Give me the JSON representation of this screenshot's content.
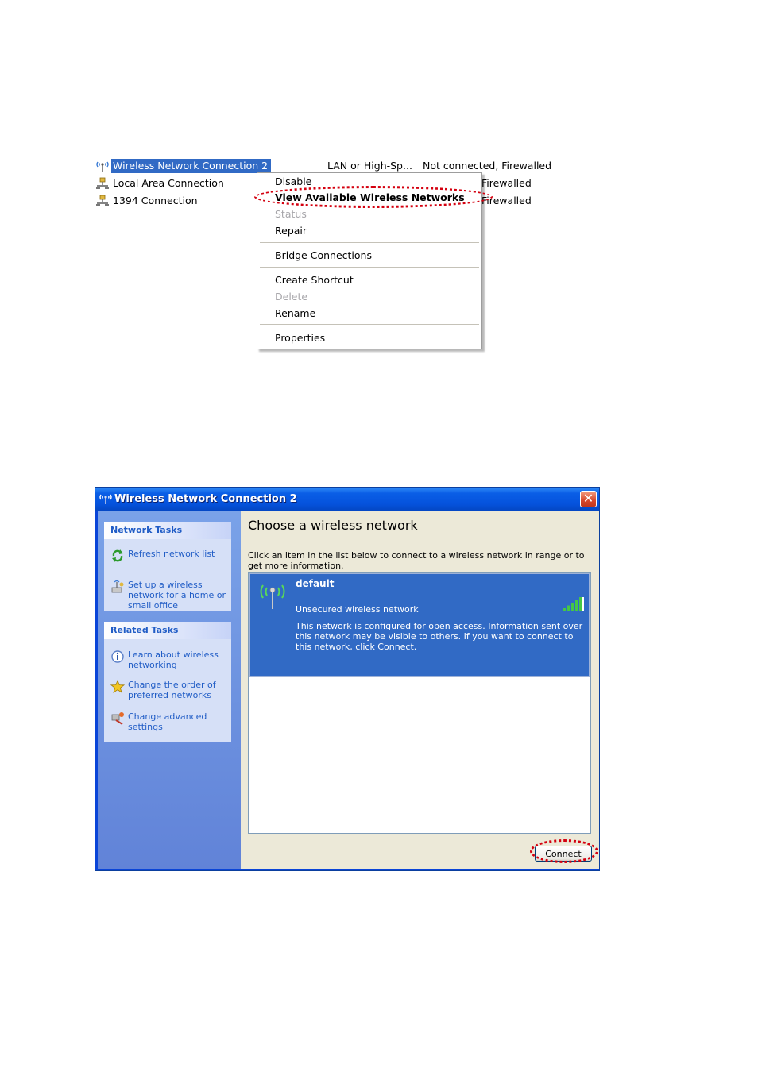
{
  "connections": {
    "rows": [
      {
        "name": "Wireless Network Connection 2",
        "type": "LAN or High-Sp...",
        "status": "Not connected, Firewalled",
        "icon": "wireless-icon",
        "selected": true
      },
      {
        "name": "Local Area Connection",
        "status_partial": "Firewalled",
        "icon": "lan-icon",
        "selected": false
      },
      {
        "name": "1394 Connection",
        "status_partial": "Firewalled",
        "icon": "lan-icon",
        "selected": false
      }
    ]
  },
  "context_menu": {
    "items": [
      {
        "label": "Disable"
      },
      {
        "label": "View Available Wireless Networks",
        "default": true
      },
      {
        "label": "Status",
        "disabled": true
      },
      {
        "label": "Repair"
      },
      {
        "label": "Bridge Connections"
      },
      {
        "label": "Create Shortcut"
      },
      {
        "label": "Delete",
        "disabled": true
      },
      {
        "label": "Rename"
      },
      {
        "label": "Properties"
      }
    ]
  },
  "window": {
    "title": "Wireless Network Connection 2",
    "close_glyph": "✕",
    "network_tasks": {
      "heading": "Network Tasks",
      "items": [
        {
          "label": "Refresh network list",
          "icon": "refresh-icon"
        },
        {
          "label": "Set up a wireless network for a home or small office",
          "icon": "setup-wireless-icon"
        }
      ]
    },
    "related_tasks": {
      "heading": "Related Tasks",
      "items": [
        {
          "label": "Learn about wireless networking",
          "icon": "info-icon"
        },
        {
          "label": "Change the order of preferred networks",
          "icon": "star-icon"
        },
        {
          "label": "Change advanced settings",
          "icon": "settings-icon"
        }
      ]
    },
    "heading": "Choose a wireless network",
    "instruction": "Click an item in the list below to connect to a wireless network in range or to get more information.",
    "networks": [
      {
        "name": "default",
        "security": "Unsecured wireless network",
        "description": "This network is configured for open access. Information sent over this network may be visible to others. If you want to connect to this network, click Connect.",
        "signal_bars": 5,
        "signal_max": 5
      }
    ],
    "connect_button": "Connect"
  },
  "colors": {
    "selection": "#316ac5",
    "highlight_ring": "#d4000f",
    "link_text": "#215dc6",
    "signal_green": "#45c845"
  }
}
